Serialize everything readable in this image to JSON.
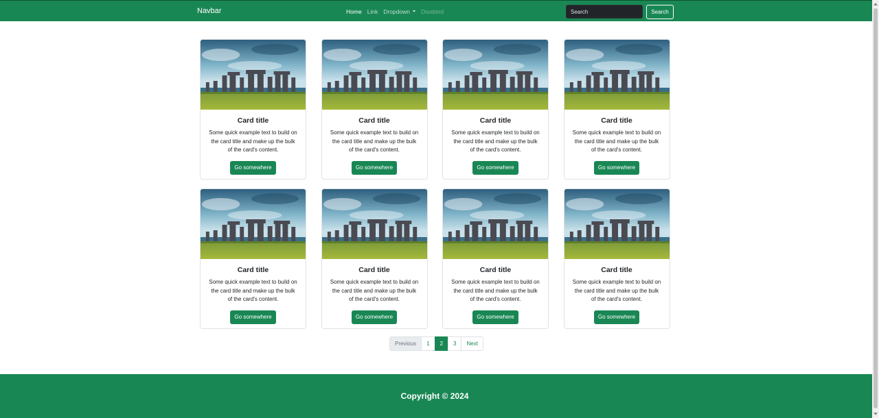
{
  "navbar": {
    "brand": "Navbar",
    "links": [
      {
        "label": "Home",
        "state": "active"
      },
      {
        "label": "Link",
        "state": "normal"
      },
      {
        "label": "Dropdown",
        "state": "dropdown"
      },
      {
        "label": "Disabled",
        "state": "disabled"
      }
    ],
    "search_placeholder": "Search",
    "search_button": "Search"
  },
  "cards": [
    {
      "image": "stonehenge-photo",
      "title": "Card title",
      "text": "Some quick example text to build on the card title and make up the bulk of the card's content.",
      "button": "Go somewhere"
    },
    {
      "image": "stonehenge-photo",
      "title": "Card title",
      "text": "Some quick example text to build on the card title and make up the bulk of the card's content.",
      "button": "Go somewhere"
    },
    {
      "image": "stonehenge-photo",
      "title": "Card title",
      "text": "Some quick example text to build on the card title and make up the bulk of the card's content.",
      "button": "Go somewhere"
    },
    {
      "image": "stonehenge-photo",
      "title": "Card title",
      "text": "Some quick example text to build on the card title and make up the bulk of the card's content.",
      "button": "Go somewhere"
    },
    {
      "image": "stonehenge-photo",
      "title": "Card title",
      "text": "Some quick example text to build on the card title and make up the bulk of the card's content.",
      "button": "Go somewhere"
    },
    {
      "image": "stonehenge-photo",
      "title": "Card title",
      "text": "Some quick example text to build on the card title and make up the bulk of the card's content.",
      "button": "Go somewhere"
    },
    {
      "image": "stonehenge-photo",
      "title": "Card title",
      "text": "Some quick example text to build on the card title and make up the bulk of the card's content.",
      "button": "Go somewhere"
    },
    {
      "image": "stonehenge-photo",
      "title": "Card title",
      "text": "Some quick example text to build on the card title and make up the bulk of the card's content.",
      "button": "Go somewhere"
    }
  ],
  "pagination": {
    "previous": "Previous",
    "pages": [
      "1",
      "2",
      "3"
    ],
    "current": "2",
    "next": "Next"
  },
  "footer": {
    "text": "Copyright © 2024"
  },
  "colors": {
    "primary": "#198754",
    "search_input_bg": "#212529",
    "border": "#dee2e6",
    "disabled_bg": "#e9ecef"
  }
}
